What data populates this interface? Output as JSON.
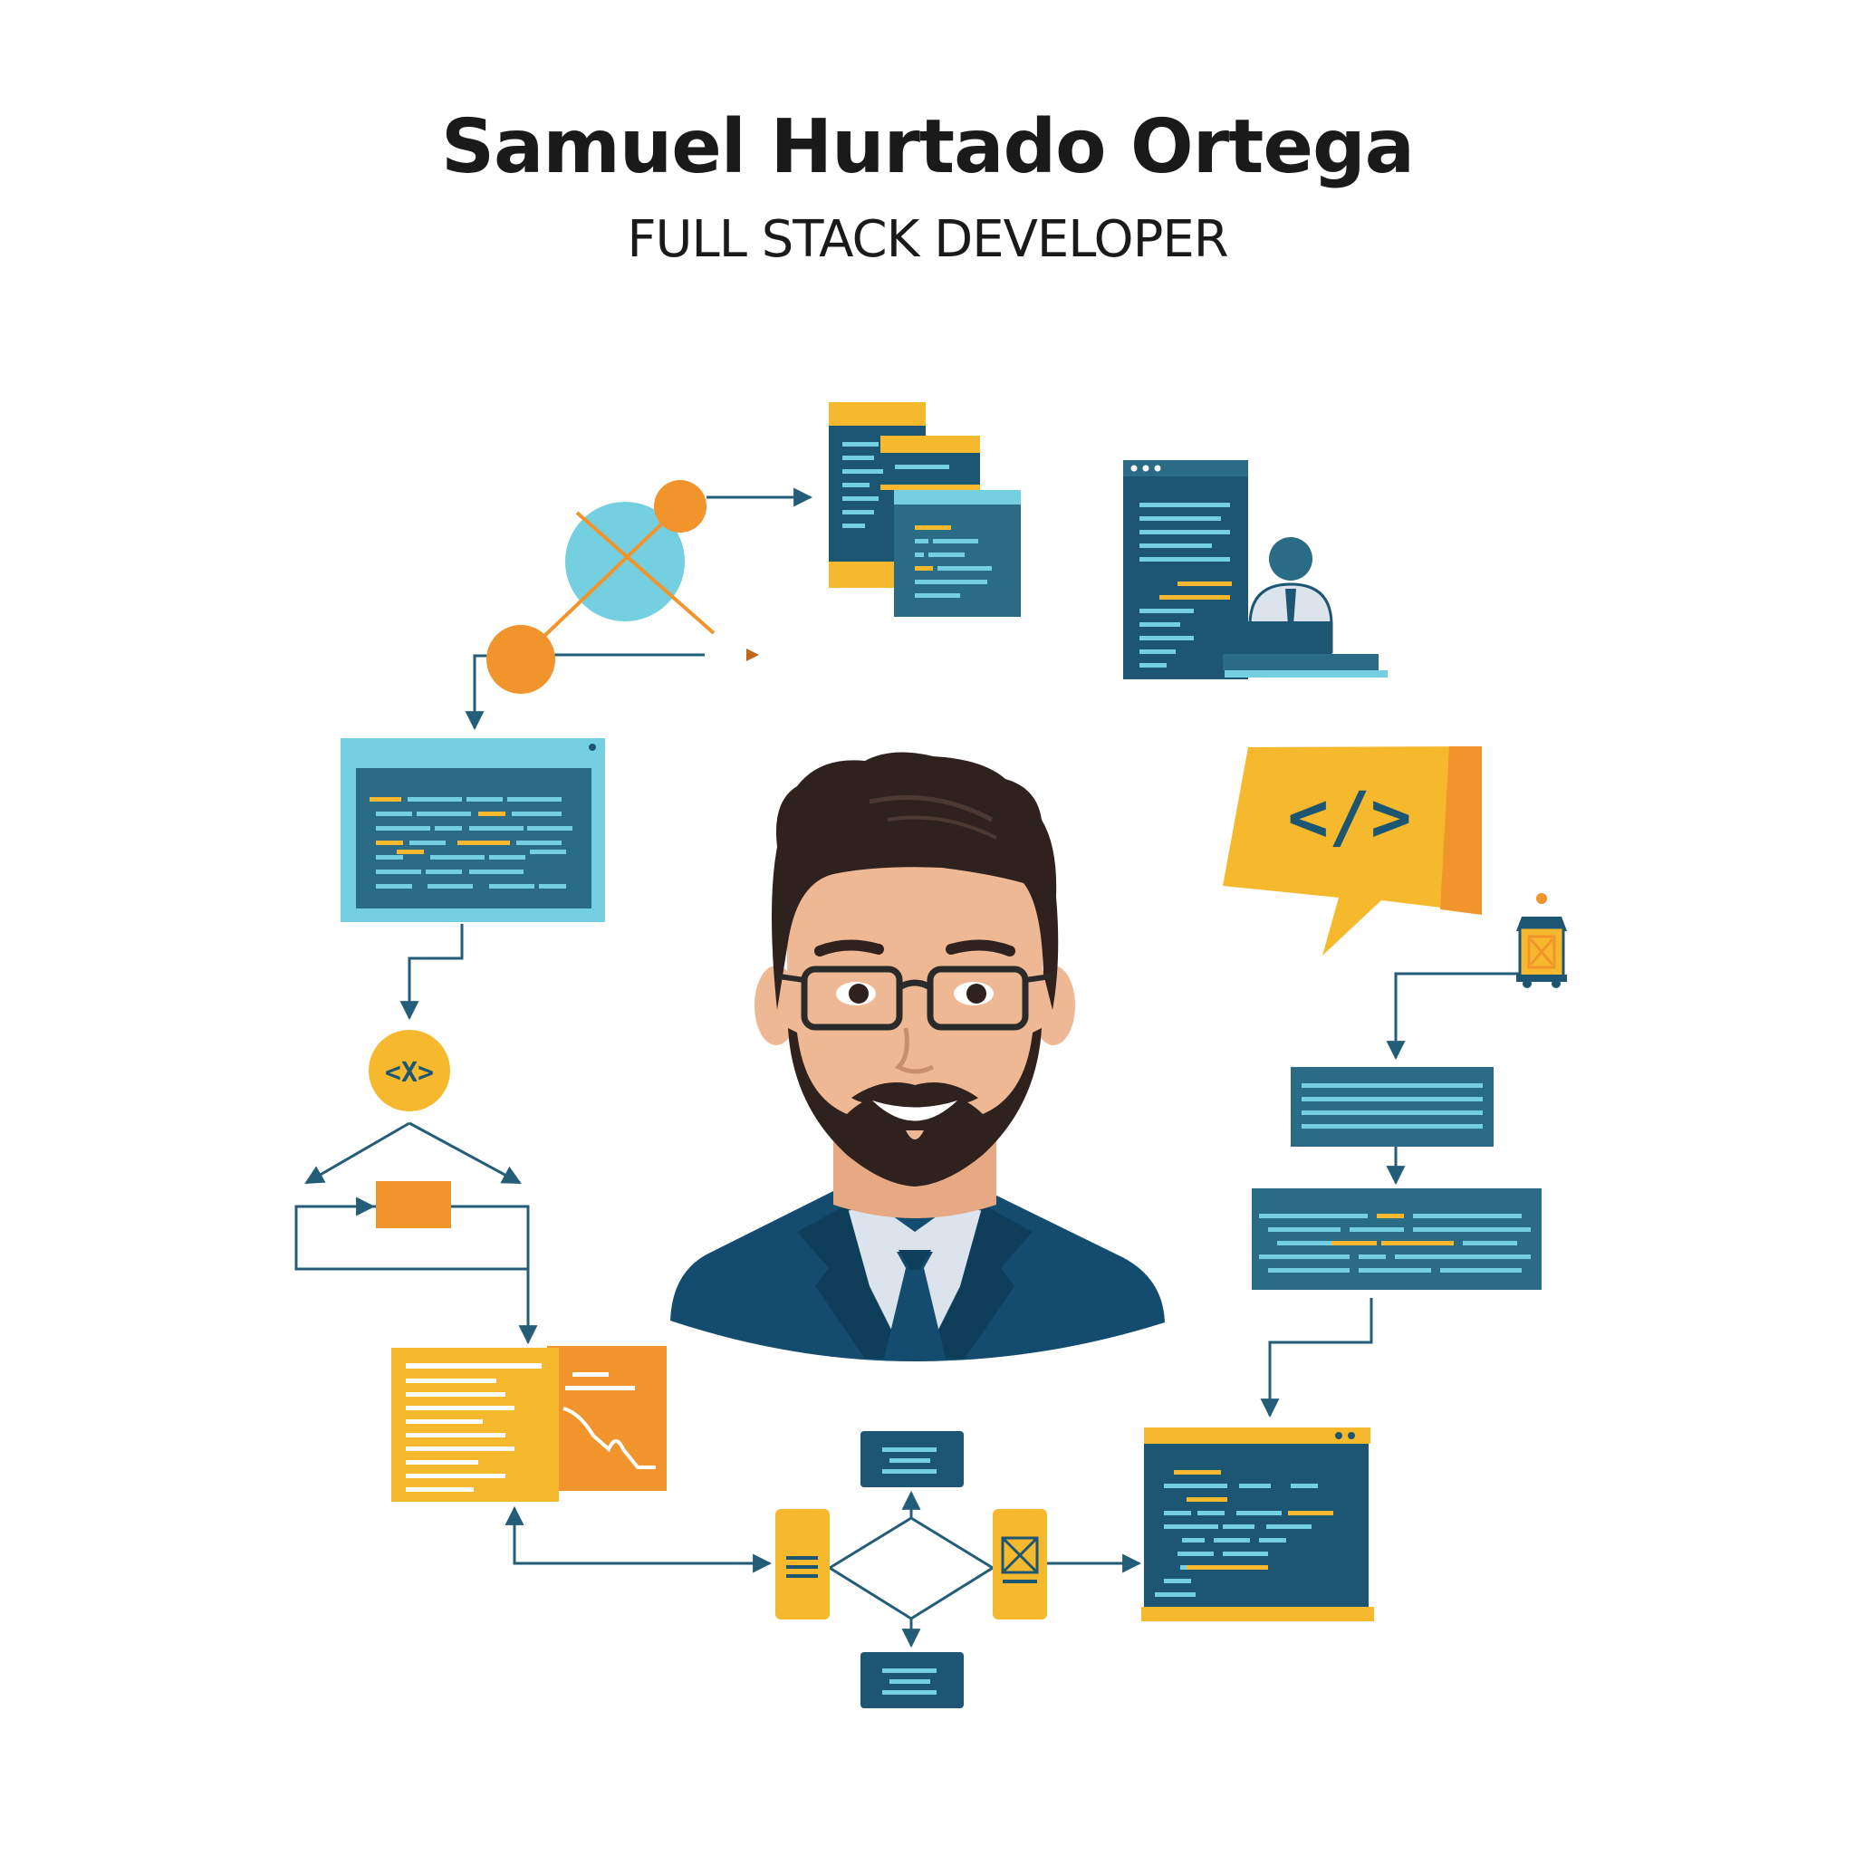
{
  "header": {
    "name": "Samuel Hurtado Ortega",
    "role": "FULL STACK DEVELOPER"
  },
  "icons": {
    "code_bubble_text": "</>",
    "code_badge_text": "<X>"
  },
  "colors": {
    "navy": "#1d5673",
    "teal": "#2a6b86",
    "light_blue": "#74cfe0",
    "yellow": "#f6b92d",
    "orange": "#f2942c",
    "skin": "#efb894",
    "hair": "#2f221e",
    "suit": "#134c6e",
    "shirt": "#dbe4ec",
    "line": "#245d78"
  }
}
